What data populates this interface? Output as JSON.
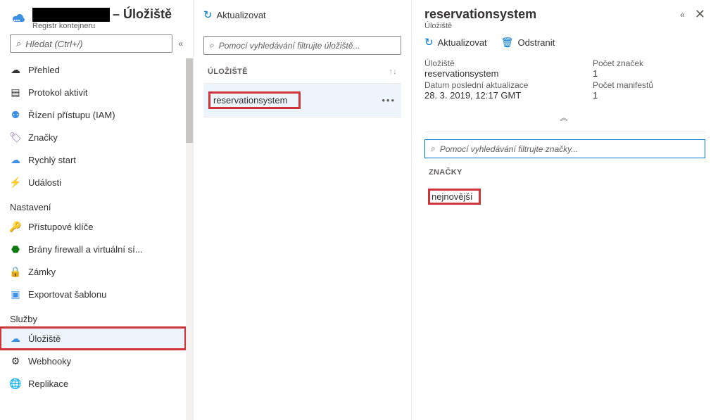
{
  "header": {
    "title_suffix": "– Úložiště",
    "subtitle": "Registr kontejneru"
  },
  "sidebar": {
    "search_placeholder": "Hledat (Ctrl+/)",
    "items": [
      {
        "label": "Přehled"
      },
      {
        "label": "Protokol aktivit"
      },
      {
        "label": "Řízení přístupu (IAM)"
      },
      {
        "label": "Značky"
      },
      {
        "label": "Rychlý start"
      },
      {
        "label": "Události"
      }
    ],
    "section1": "Nastavení",
    "settings": [
      {
        "label": "Přístupové klíče"
      },
      {
        "label": "Brány firewall a virtuální sí..."
      },
      {
        "label": "Zámky"
      },
      {
        "label": "Exportovat šablonu"
      }
    ],
    "section2": "Služby",
    "services": [
      {
        "label": "Úložiště"
      },
      {
        "label": "Webhooky"
      },
      {
        "label": "Replikace"
      }
    ]
  },
  "middle": {
    "refresh": "Aktualizovat",
    "filter_placeholder": "Pomocí vyhledávání filtrujte úložiště...",
    "column_header": "ÚLOŽIŠTĚ",
    "rows": [
      {
        "name": "reservationsystem"
      }
    ]
  },
  "detail": {
    "title": "reservationsystem",
    "subtitle": "Úložiště",
    "refresh": "Aktualizovat",
    "delete": "Odstranit",
    "props": {
      "repo_label": "Úložiště",
      "repo_value": "reservationsystem",
      "tags_label": "Počet značek",
      "tags_value": "1",
      "updated_label": "Datum poslední aktualizace",
      "updated_value": "28. 3. 2019, 12:17 GMT",
      "manifests_label": "Počet manifestů",
      "manifests_value": "1"
    },
    "expand": "︽",
    "filter_placeholder": "Pomocí vyhledávání filtrujte značky...",
    "tags_header": "ZNAČKY",
    "tags": [
      {
        "name": "nejnovější"
      }
    ]
  }
}
